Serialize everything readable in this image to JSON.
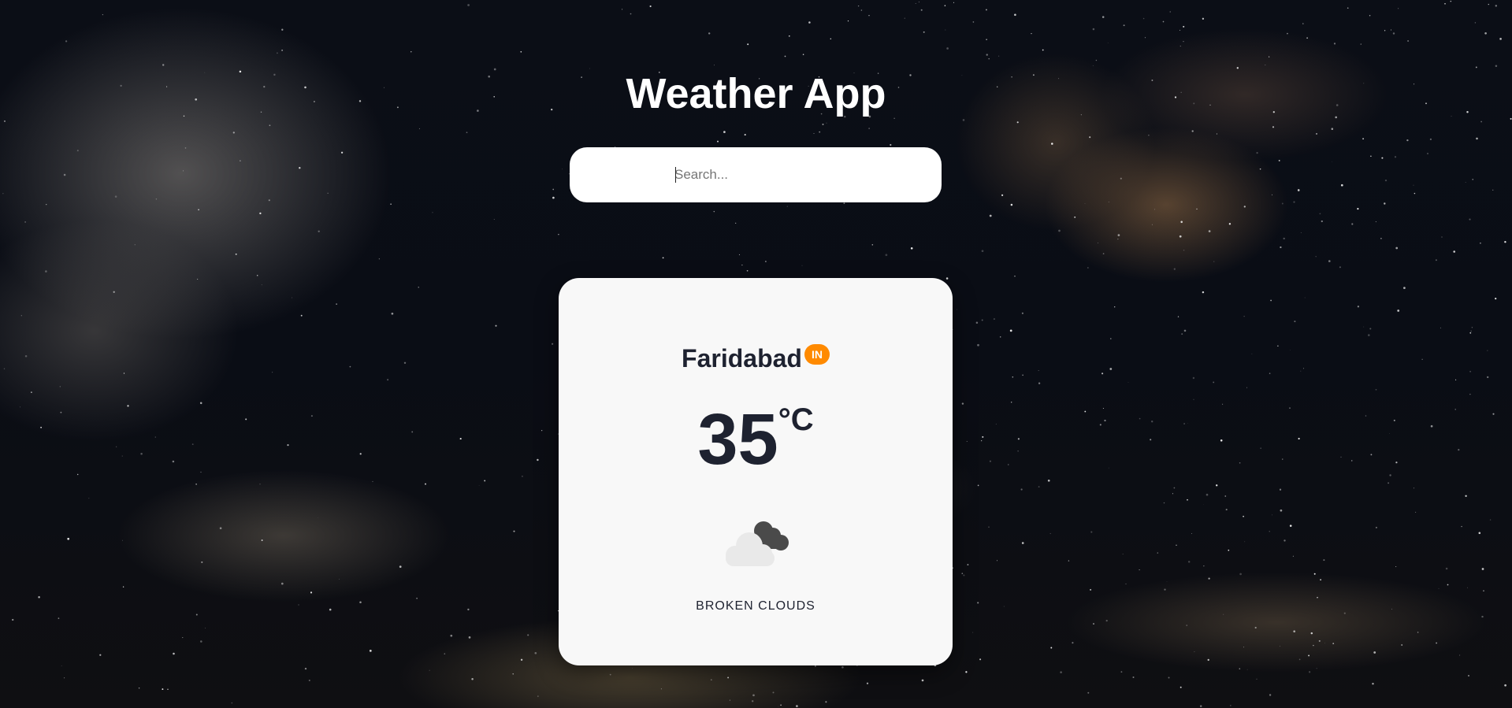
{
  "app": {
    "title": "Weather App"
  },
  "search": {
    "placeholder": "Search...",
    "value": ""
  },
  "weather": {
    "city": "Faridabad",
    "country": "IN",
    "temperature": "35",
    "unit": "°C",
    "description": "BROKEN CLOUDS",
    "icon": "broken-clouds-icon"
  },
  "colors": {
    "accent": "#ff8a00",
    "card_background": "#f8f8f8",
    "text_dark": "#1e2230"
  }
}
